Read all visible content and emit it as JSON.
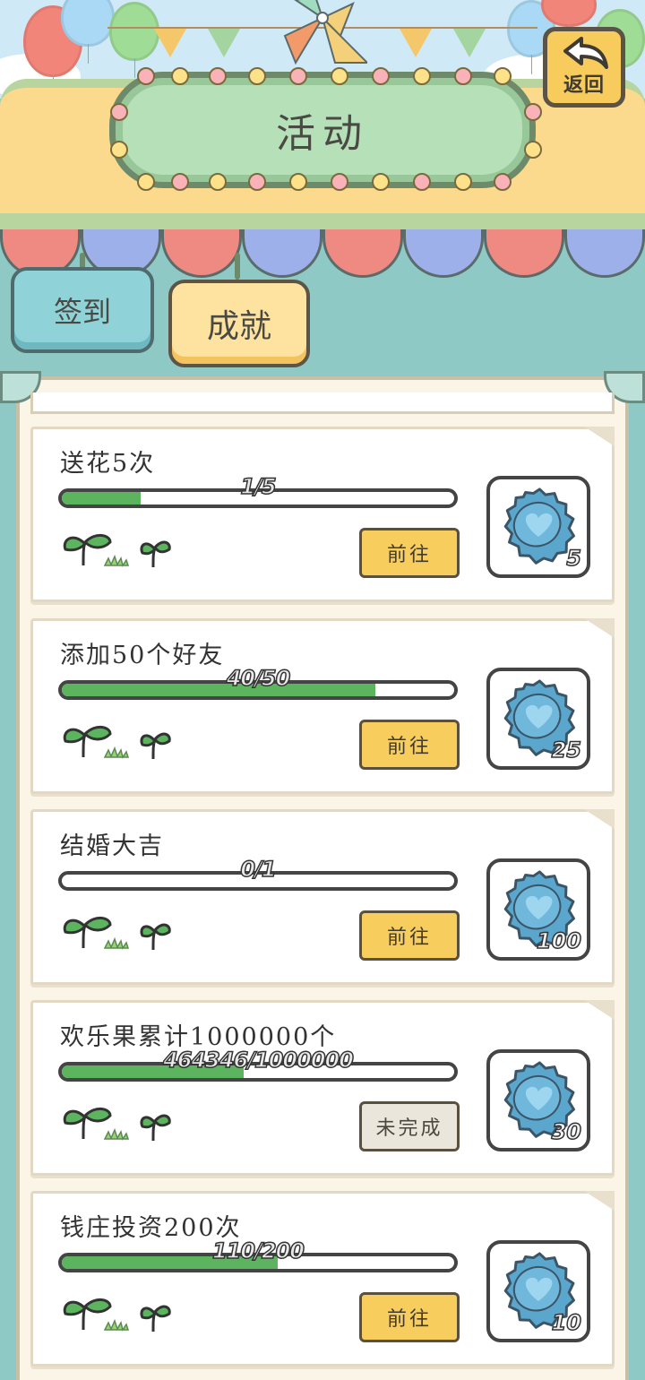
{
  "header": {
    "title": "活动",
    "back_label": "返回"
  },
  "tabs": [
    {
      "label": "签到",
      "active": false
    },
    {
      "label": "成就",
      "active": true
    }
  ],
  "achievements": [
    {
      "title": "送花5次",
      "progress_text": "1/5",
      "progress": 0.2,
      "button": "前往",
      "completed_state": false,
      "reward_icon": "bottle-cap-icon",
      "reward": "5"
    },
    {
      "title": "添加50个好友",
      "progress_text": "40/50",
      "progress": 0.8,
      "button": "前往",
      "completed_state": false,
      "reward_icon": "bottle-cap-icon",
      "reward": "25"
    },
    {
      "title": "结婚大吉",
      "progress_text": "0/1",
      "progress": 0.0,
      "button": "前往",
      "completed_state": false,
      "reward_icon": "bottle-cap-icon",
      "reward": "100"
    },
    {
      "title": "欢乐果累计1000000个",
      "progress_text": "464346/1000000",
      "progress": 0.464346,
      "button": "未完成",
      "completed_state": true,
      "reward_icon": "bottle-cap-icon",
      "reward": "30"
    },
    {
      "title": "钱庄投资200次",
      "progress_text": "110/200",
      "progress": 0.55,
      "button": "前往",
      "completed_state": false,
      "reward_icon": "bottle-cap-icon",
      "reward": "10"
    }
  ],
  "colors": {
    "progress_fill": "#5cb45e",
    "go_button": "#f7cd5e",
    "incomplete_button": "#ebe6dc",
    "reward_cap": "#5aa6cc",
    "background": "#8ec9c6"
  }
}
